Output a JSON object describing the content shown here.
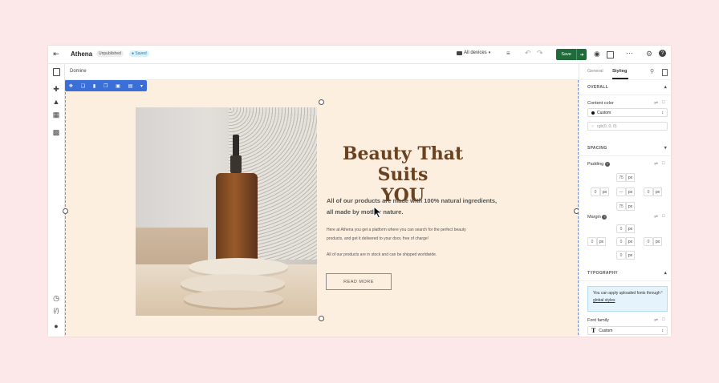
{
  "topbar": {
    "site_name": "Athena",
    "status_badge": "Unpublished",
    "saved_badge": "Saved",
    "device_select": "All devices",
    "save_button": "Save"
  },
  "breadcrumb": {
    "label": "Domine"
  },
  "hero": {
    "title_line1": "Beauty That Suits",
    "title_line2": "YOU",
    "lead_line1": "All of our products are made with 100% natural ingredients,",
    "lead_line2": "all made by mother nature.",
    "body_line1": "Here at Athena you get a platform where you can search for the perfect beauty",
    "body_line2": "products, and get it delivered to your door, free of charge!",
    "body2": "All of our products are in stock and can be shipped worldwide.",
    "cta": "READ MORE"
  },
  "panel": {
    "tab_general": "General",
    "tab_styling": "Styling",
    "overall": "OVERALL",
    "content_color_label": "Content color",
    "content_color_value": "Custom",
    "rgba_value": "rgb(0, 0, 0)",
    "spacing": "SPACING",
    "padding_label": "Padding",
    "padding_top": "75",
    "padding_bottom": "75",
    "padding_left": "0",
    "padding_right": "0",
    "padding_center": "—",
    "margin_label": "Margin",
    "margin_top": "0",
    "margin_bottom": "0",
    "margin_left": "0",
    "margin_right": "0",
    "unit": "px",
    "typography": "TYPOGRAPHY",
    "notice_text": "You can apply uploaded fonts through",
    "notice_link": "global styles",
    "font_family_label": "Font family",
    "font_family_value": "Custom"
  },
  "colors": {
    "save_green": "#1f6b3a",
    "canvas_bg": "#fcefe0",
    "title_brown": "#6b4220",
    "accent_blue": "#3b6fd8"
  }
}
